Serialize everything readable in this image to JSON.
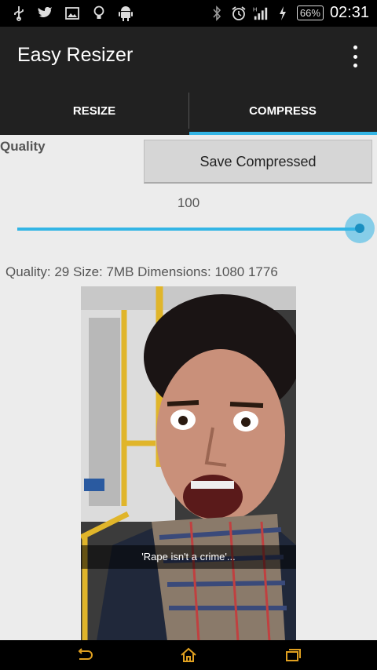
{
  "status_bar": {
    "battery": "66%",
    "time": "02:31",
    "left_icons": [
      "usb-icon",
      "twitter-icon",
      "gallery-icon",
      "lightbulb-icon",
      "android-icon"
    ],
    "right_icons": [
      "bluetooth-icon",
      "alarm-icon",
      "signal-icon",
      "charging-icon"
    ]
  },
  "action_bar": {
    "title": "Easy Resizer",
    "overflow_icon": "overflow-menu-icon"
  },
  "tabs": [
    {
      "label": "RESIZE",
      "selected": false
    },
    {
      "label": "COMPRESS",
      "selected": true
    }
  ],
  "compress": {
    "quality_label": "Quality",
    "save_button": "Save Compressed",
    "slider_value": "100",
    "slider_level": 1.0,
    "info": "Quality: 29   Size: 7MB Dimensions: 1080 1776"
  },
  "photo": {
    "caption": "'Rape isn't a crime'..."
  },
  "nav_bar": {
    "buttons": [
      "back-icon",
      "home-icon",
      "recent-apps-icon"
    ]
  },
  "colors": {
    "accent": "#33b5e5",
    "action_bar": "#212121",
    "background": "#ececec"
  }
}
